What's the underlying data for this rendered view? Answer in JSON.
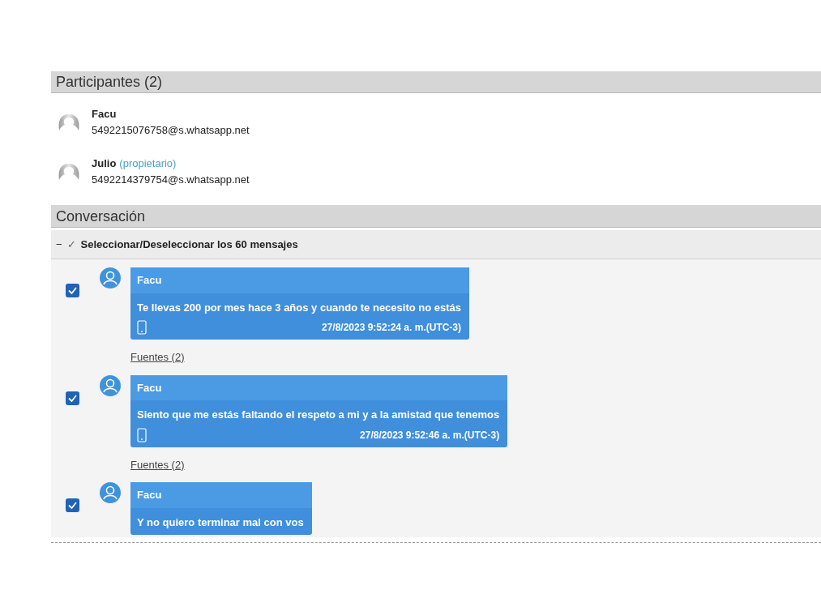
{
  "participants": {
    "title": "Participantes (2)",
    "items": [
      {
        "name": "Facu",
        "address": "5492215076758@s.whatsapp.net"
      },
      {
        "name": "Julio",
        "role": "(propietario)",
        "address": "5492214379754@s.whatsapp.net"
      }
    ]
  },
  "conversation": {
    "title": "Conversación",
    "select_all": {
      "collapse": "−",
      "check": "✓",
      "label": "Seleccionar/Deseleccionar los 60 mensajes"
    },
    "messages": [
      {
        "checked": true,
        "sender": "Facu",
        "text": "Te llevas 200 por mes hace 3 años y cuando te necesito no estás",
        "timestamp": "27/8/2023 9:52:24 a. m.(UTC-3)",
        "sources": "Fuentes (2)"
      },
      {
        "checked": true,
        "sender": "Facu",
        "text": "Siento que me estás faltando el respeto a mi y a la amistad que tenemos",
        "timestamp": "27/8/2023 9:52:46 a. m.(UTC-3)",
        "sources": "Fuentes (2)"
      },
      {
        "checked": true,
        "sender": "Facu",
        "text": "Y no quiero terminar mal con vos"
      }
    ]
  }
}
